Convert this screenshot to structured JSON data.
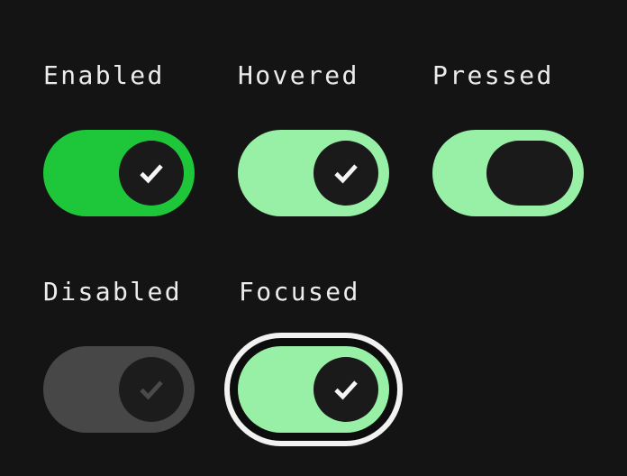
{
  "colors": {
    "background": "#141414",
    "enabled_track": "#1ec73a",
    "active_track": "#98f0a6",
    "disabled_track": "#474747",
    "thumb": "#1a1a1a",
    "check": "#f5f5f5",
    "disabled_check": "#4a4a4a",
    "focus_ring": "#f2f2f2"
  },
  "switches": [
    {
      "label": "Enabled",
      "state": "enabled",
      "checked": true,
      "icon": "check-icon"
    },
    {
      "label": "Hovered",
      "state": "hovered",
      "checked": true,
      "icon": "check-icon"
    },
    {
      "label": "Pressed",
      "state": "pressed",
      "checked": true,
      "icon": ""
    },
    {
      "label": "Disabled",
      "state": "disabled",
      "checked": true,
      "icon": "check-icon"
    },
    {
      "label": "Focused",
      "state": "focused",
      "checked": true,
      "icon": "check-icon"
    }
  ]
}
